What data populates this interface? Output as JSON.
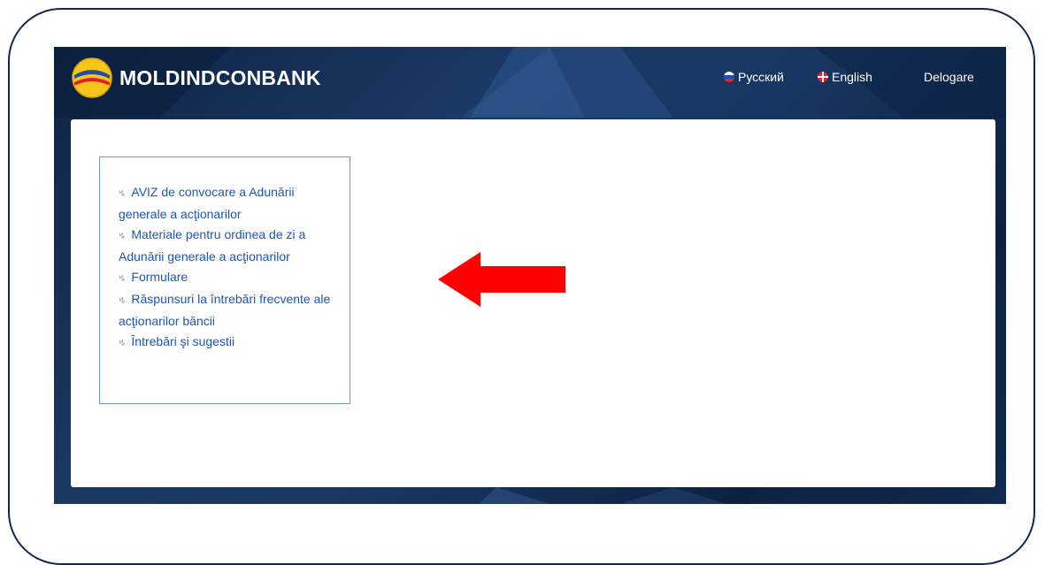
{
  "header": {
    "brand": "MOLDINDCONBANK",
    "logo_icon": "moldindconbank-logo-icon",
    "languages": [
      {
        "label": "Русский",
        "icon": "flag-ru-icon"
      },
      {
        "label": "English",
        "icon": "flag-uk-icon"
      }
    ],
    "logout_label": "Delogare"
  },
  "menu": {
    "items": [
      {
        "label": "AVIZ de convocare a Adunării generale a acţionarilor"
      },
      {
        "label": "Materiale pentru ordinea de zi a Adunării generale a acţionarilor"
      },
      {
        "label": "Formulare"
      },
      {
        "label": "Răspunsuri la întrebări frecvente ale acţionarilor băncii"
      },
      {
        "label": "Întrebări şi sugestii"
      }
    ]
  },
  "annotation": {
    "arrow_color": "#ff0000"
  },
  "colors": {
    "background_dark": "#14305a",
    "link": "#1c56b8",
    "menu_border": "#6f95d6",
    "frame": "#0f2a4e"
  }
}
